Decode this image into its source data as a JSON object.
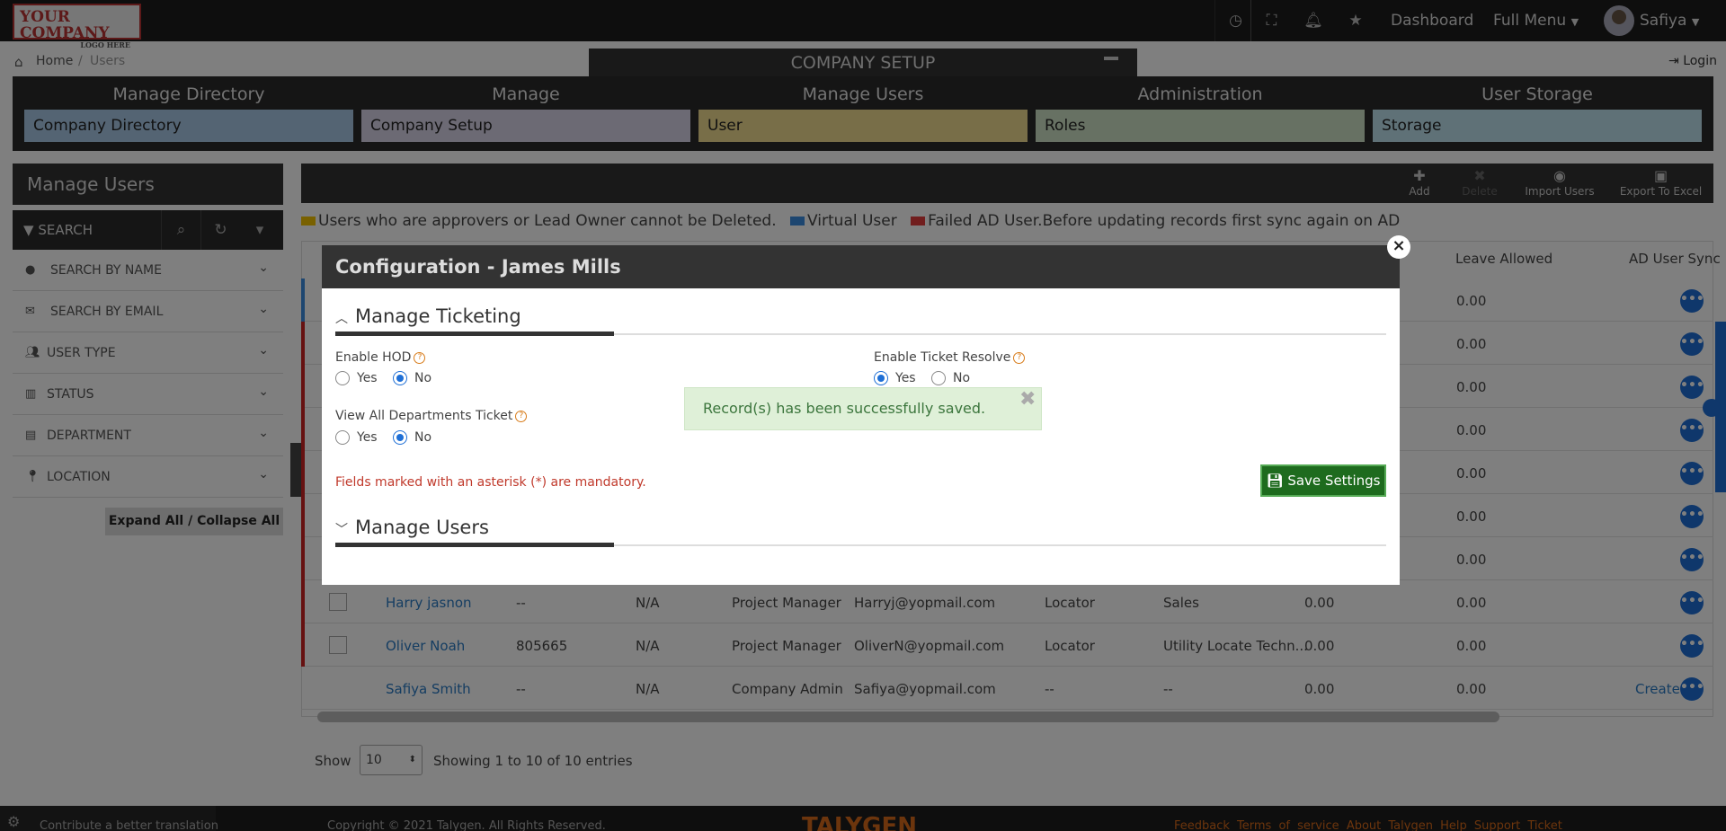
{
  "brand": {
    "logo_main": "YOUR COMPANY",
    "logo_sub": "LOGO HERE"
  },
  "topbar": {
    "icons": [
      "clock-icon",
      "fullscreen-icon",
      "bell-icon",
      "star-icon"
    ],
    "dashboard": "Dashboard",
    "full_menu": "Full Menu",
    "user_name": "Safiya"
  },
  "breadcrumb": {
    "home": "Home",
    "sep": "/",
    "current": "Users",
    "login": "Login"
  },
  "company_setup": {
    "title": "COMPANY SETUP"
  },
  "categories": [
    {
      "heading": "Manage Directory",
      "item": "Company Directory",
      "color": "#a8c8e6"
    },
    {
      "heading": "Manage",
      "item": "Company Setup",
      "color": "#d9d4e8"
    },
    {
      "heading": "Manage Users",
      "item": "User",
      "color": "#f1dd91"
    },
    {
      "heading": "Administration",
      "item": "Roles",
      "color": "#cfe3c7"
    },
    {
      "heading": "User Storage",
      "item": "Storage",
      "color": "#bfe2ee"
    }
  ],
  "sidebar": {
    "title": "Manage Users",
    "search_label": "SEARCH",
    "filters": [
      "SEARCH BY NAME",
      "SEARCH BY EMAIL",
      "USER TYPE",
      "STATUS",
      "DEPARTMENT",
      "LOCATION"
    ],
    "expand_collapse": "Expand All / Collapse All"
  },
  "toolbar": {
    "add": "Add",
    "delete": "Delete",
    "import": "Import Users",
    "export": "Export To Excel"
  },
  "legend": {
    "approvers": "Users who are approvers or Lead Owner cannot be Deleted.",
    "virtual": "Virtual User",
    "failed": "Failed AD User.Before updating records first sync again on AD",
    "colors": {
      "approvers": "#f2c300",
      "virtual": "#3b8de0",
      "failed": "#e23c3c"
    }
  },
  "table": {
    "headers": {
      "leave_allowed": "Leave Allowed",
      "ad_sync": "AD User Sync"
    },
    "hidden_leave_values": [
      "0.00",
      "0.00",
      "0.00",
      "0.00",
      "0.00",
      "0.00",
      "0.00"
    ],
    "rows": [
      {
        "name": "Harry jasnon",
        "id": "--",
        "na": "N/A",
        "role": "Project Manager",
        "email": "Harryj@yopmail.com",
        "loc": "Locator",
        "dept": "Sales",
        "v1": "0.00",
        "v2": "0.00",
        "sync": ""
      },
      {
        "name": "Oliver Noah",
        "id": "805665",
        "na": "N/A",
        "role": "Project Manager",
        "email": "OliverN@yopmail.com",
        "loc": "Locator",
        "dept": "Utility Locate Techn...",
        "v1": "0.00",
        "v2": "0.00",
        "sync": ""
      },
      {
        "name": "Safiya Smith",
        "id": "--",
        "na": "N/A",
        "role": "Company Admin",
        "email": "Safiya@yopmail.com",
        "loc": "--",
        "dept": "--",
        "v1": "0.00",
        "v2": "0.00",
        "sync": "Create"
      }
    ]
  },
  "pagination": {
    "show": "Show",
    "page_size": "10",
    "showing": "Showing 1 to 10 of 10 entries"
  },
  "footer": {
    "translate": "Contribute a better translation",
    "copyright": "Copyright © 2021 Talygen. All Rights Reserved.",
    "brand": "TALYGEN",
    "links": "Feedback  Terms of service  About Talygen  Help  Support Ticket"
  },
  "modal": {
    "title": "Configuration - James Mills",
    "section1": "Manage Ticketing",
    "enable_hod": "Enable HOD",
    "enable_ticket_resolve": "Enable Ticket Resolve",
    "view_all": "View All Departments Ticket",
    "yes": "Yes",
    "no": "No",
    "mandatory": "Fields marked with an asterisk (*) are mandatory.",
    "save": "Save Settings",
    "section2": "Manage Users",
    "close": "×"
  },
  "toast": {
    "message": "Record(s) has been successfully saved.",
    "close": "✖"
  }
}
